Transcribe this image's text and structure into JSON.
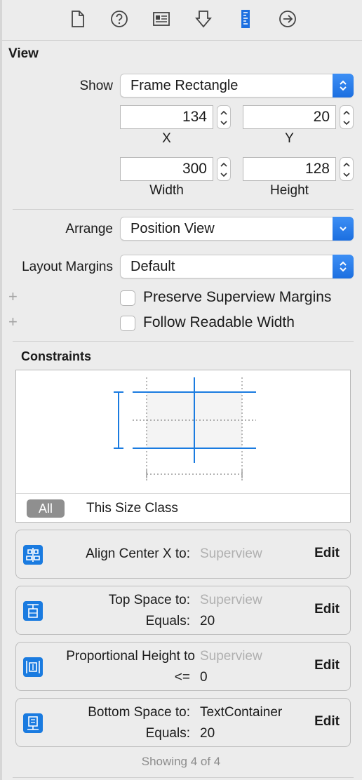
{
  "tabs": [
    {
      "icon": "file-icon",
      "active": false
    },
    {
      "icon": "help-icon",
      "active": false
    },
    {
      "icon": "identity-icon",
      "active": false
    },
    {
      "icon": "attributes-icon",
      "active": false
    },
    {
      "icon": "size-ruler-icon",
      "active": true
    },
    {
      "icon": "connections-icon",
      "active": false
    }
  ],
  "view": {
    "title": "View",
    "show_label": "Show",
    "show_value": "Frame Rectangle",
    "x_value": "134",
    "y_value": "20",
    "x_label": "X",
    "y_label": "Y",
    "width_value": "300",
    "height_value": "128",
    "width_label": "Width",
    "height_label": "Height",
    "arrange_label": "Arrange",
    "arrange_value": "Position View",
    "margins_label": "Layout Margins",
    "margins_value": "Default",
    "preserve_label": "Preserve Superview Margins",
    "readable_label": "Follow Readable Width",
    "plus_symbol": "+"
  },
  "constraints": {
    "title": "Constraints",
    "seg_all": "All",
    "seg_class": "This Size Class",
    "items": [
      {
        "icon": "align-center-x-icon",
        "line1_label": "Align Center X to:",
        "line1_value": "Superview",
        "edit": "Edit"
      },
      {
        "icon": "top-space-icon",
        "line1_label": "Top Space to:",
        "line1_value": "Superview",
        "line2_label": "Equals:",
        "line2_value": "20",
        "edit": "Edit"
      },
      {
        "icon": "proportional-height-icon",
        "line1_label": "Proportional Height to",
        "line1_value": "Superview",
        "line2_label": "<=",
        "line2_value": "0",
        "edit": "Edit"
      },
      {
        "icon": "bottom-space-icon",
        "line1_label": "Bottom Space to:",
        "line1_value": "TextContainer",
        "line2_label": "Equals:",
        "line2_value": "20",
        "edit": "Edit"
      }
    ],
    "footer": "Showing 4 of 4"
  },
  "colors": {
    "accent": "#1c6fe0",
    "constraint_blue": "#1a7be0",
    "muted": "#b0b0b0"
  }
}
